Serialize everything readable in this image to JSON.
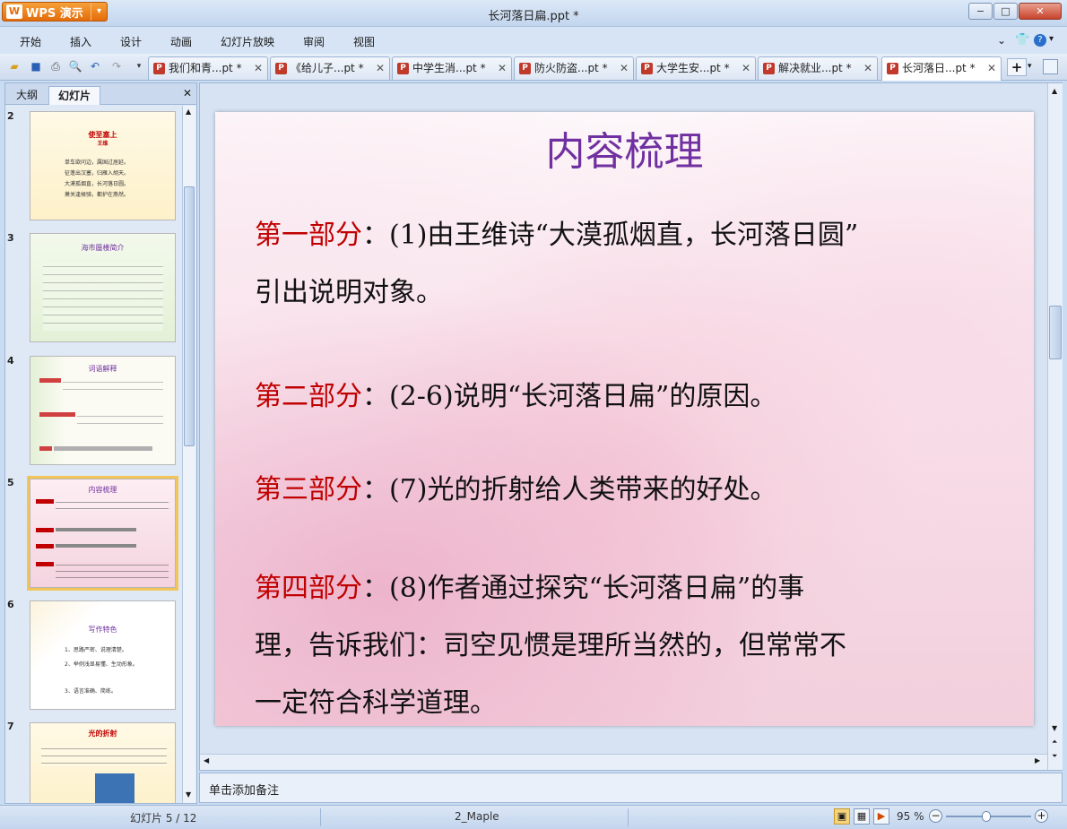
{
  "app": {
    "name": "WPS 演示",
    "logo_text": "W",
    "window_title": "长河落日扁.ppt *"
  },
  "window_controls": {
    "minimize": "−",
    "maximize": "□",
    "close": "✕"
  },
  "menu": {
    "items": [
      "开始",
      "插入",
      "设计",
      "动画",
      "幻灯片放映",
      "审阅",
      "视图"
    ],
    "right_icons": [
      "chevron-down-icon",
      "shirt-icon",
      "help-icon"
    ]
  },
  "toolbar": {
    "icons": [
      "open-icon",
      "save-icon",
      "print-icon",
      "print-preview-icon",
      "undo-icon",
      "redo-icon",
      "quick-access-menu-icon"
    ]
  },
  "doc_tabs": [
    {
      "label": "我们和青...pt *",
      "active": false
    },
    {
      "label": "《给儿子...pt *",
      "active": false
    },
    {
      "label": "中学生消...pt *",
      "active": false
    },
    {
      "label": "防火防盗...pt *",
      "active": false
    },
    {
      "label": "大学生安...pt *",
      "active": false
    },
    {
      "label": "解决就业...pt *",
      "active": false
    },
    {
      "label": "长河落日...pt *",
      "active": true
    }
  ],
  "left_panel": {
    "tabs": [
      "大纲",
      "幻灯片"
    ],
    "active_tab": "幻灯片",
    "close": "✕",
    "thumbnails": [
      {
        "num": "2",
        "title": "使至塞上",
        "subtitle": "王维",
        "lines": [
          "单车欲问边，属国过居延。",
          "征蓬出汉塞，归雁入胡天。",
          "大漠孤烟直，长河落日圆。",
          "萧关逢候骑，都护在燕然。"
        ]
      },
      {
        "num": "3",
        "title": "海市蜃楼简介"
      },
      {
        "num": "4",
        "title": "词语解释"
      },
      {
        "num": "5",
        "title": "内容梳理",
        "selected": true
      },
      {
        "num": "6",
        "title": "写作特色",
        "lines": [
          "1、思路严密、说理清楚。",
          "2、举例浅显易懂、生动形象。",
          "3、语言准确、简练。"
        ]
      },
      {
        "num": "7",
        "title": "光的折射"
      }
    ]
  },
  "slide": {
    "title": "内容梳理",
    "parts": [
      {
        "label": "第一部分",
        "line1": "：(1)由王维诗“大漠孤烟直，长河落日圆”",
        "line2": "引出说明对象。"
      },
      {
        "label": "第二部分",
        "line1": "：(2-6)说明“长河落日扁”的原因。"
      },
      {
        "label": "第三部分",
        "line1": "：(7)光的折射给人类带来的好处。"
      },
      {
        "label": "第四部分",
        "line1": "：(8)作者通过探究“长河落日扁”的事",
        "line2": "理，告诉我们：司空见惯是理所当然的，但常常不",
        "line3": "一定符合科学道理。"
      }
    ]
  },
  "notes": {
    "placeholder": "单击添加备注"
  },
  "status": {
    "slide_counter": "幻灯片 5 / 12",
    "theme": "2_Maple",
    "zoom": "95 %",
    "zoom_percent": 95
  }
}
